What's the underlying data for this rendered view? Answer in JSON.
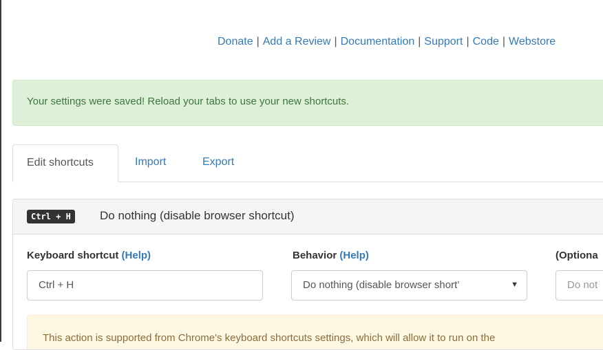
{
  "header": {
    "links": [
      "Donate",
      "Add a Review",
      "Documentation",
      "Support",
      "Code",
      "Webstore"
    ],
    "separator": "|"
  },
  "alert": {
    "message": "Your settings were saved! Reload your tabs to use your new shortcuts."
  },
  "tabs": [
    {
      "label": "Edit shortcuts"
    },
    {
      "label": "Import"
    },
    {
      "label": "Export"
    }
  ],
  "shortcut": {
    "key_badge": "Ctrl + H",
    "title": "Do nothing (disable browser shortcut)",
    "keyboard_label": "Keyboard shortcut",
    "behavior_label": "Behavior",
    "help_text": "(Help)",
    "optional_label": "(Optiona",
    "keyboard_value": "Ctrl + H",
    "behavior_value": "Do nothing (disable browser short’",
    "optional_placeholder": "Do not",
    "notice": "This action is supported from Chrome's keyboard shortcuts settings, which will allow it to run on the"
  }
}
